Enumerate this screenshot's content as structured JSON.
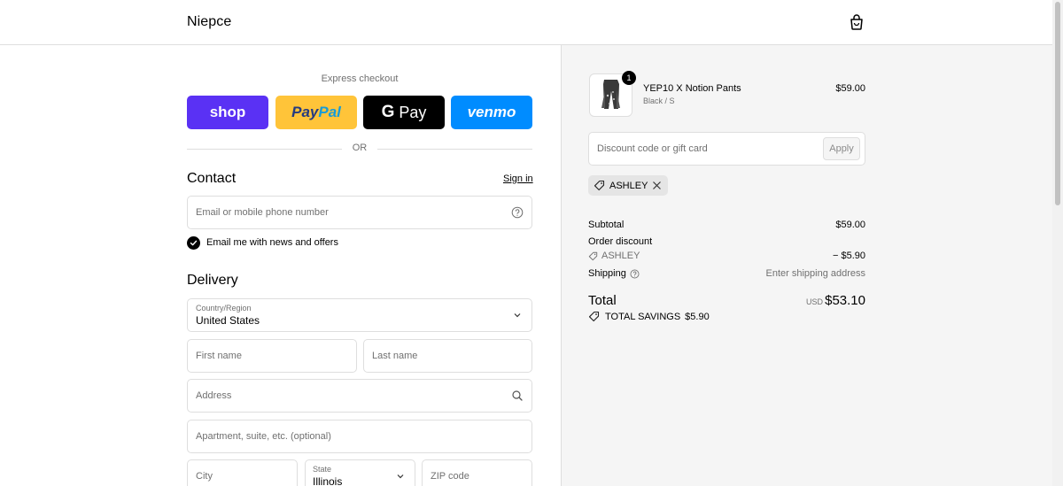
{
  "header": {
    "brand": "Niepce",
    "cart_icon": "shopping-bag-icon"
  },
  "express": {
    "title": "Express checkout",
    "buttons": {
      "shop": "shop",
      "paypal_1": "Pay",
      "paypal_2": "Pal",
      "gpay_g": "G",
      "gpay_text": "Pay",
      "venmo": "venmo"
    },
    "or": "OR"
  },
  "contact": {
    "title": "Contact",
    "sign_in": "Sign in",
    "email_placeholder": "Email or mobile phone number",
    "newsletter_label": "Email me with news and offers",
    "newsletter_checked": true
  },
  "delivery": {
    "title": "Delivery",
    "country_label": "Country/Region",
    "country_value": "United States",
    "first_name": "First name",
    "last_name": "Last name",
    "address": "Address",
    "apartment": "Apartment, suite, etc. (optional)",
    "city": "City",
    "state_label": "State",
    "state_value": "Illinois",
    "zip": "ZIP code"
  },
  "summary": {
    "item": {
      "name": "YEP10 X Notion Pants",
      "variant": "Black / S",
      "price": "$59.00",
      "quantity": "1"
    },
    "discount_placeholder": "Discount code or gift card",
    "apply": "Apply",
    "applied_code": "ASHLEY",
    "subtotal_label": "Subtotal",
    "subtotal": "$59.00",
    "order_discount_label": "Order discount",
    "discount_code": "ASHLEY",
    "discount_amount": "− $5.90",
    "shipping_label": "Shipping",
    "shipping_value": "Enter shipping address",
    "total_label": "Total",
    "currency": "USD",
    "total": "$53.10",
    "savings_label": "TOTAL SAVINGS",
    "savings": "$5.90"
  },
  "colors": {
    "shop": "#5a31f4",
    "paypal": "#ffc439",
    "gpay": "#000000",
    "venmo": "#008cff",
    "summary_bg": "#f5f5f5"
  }
}
